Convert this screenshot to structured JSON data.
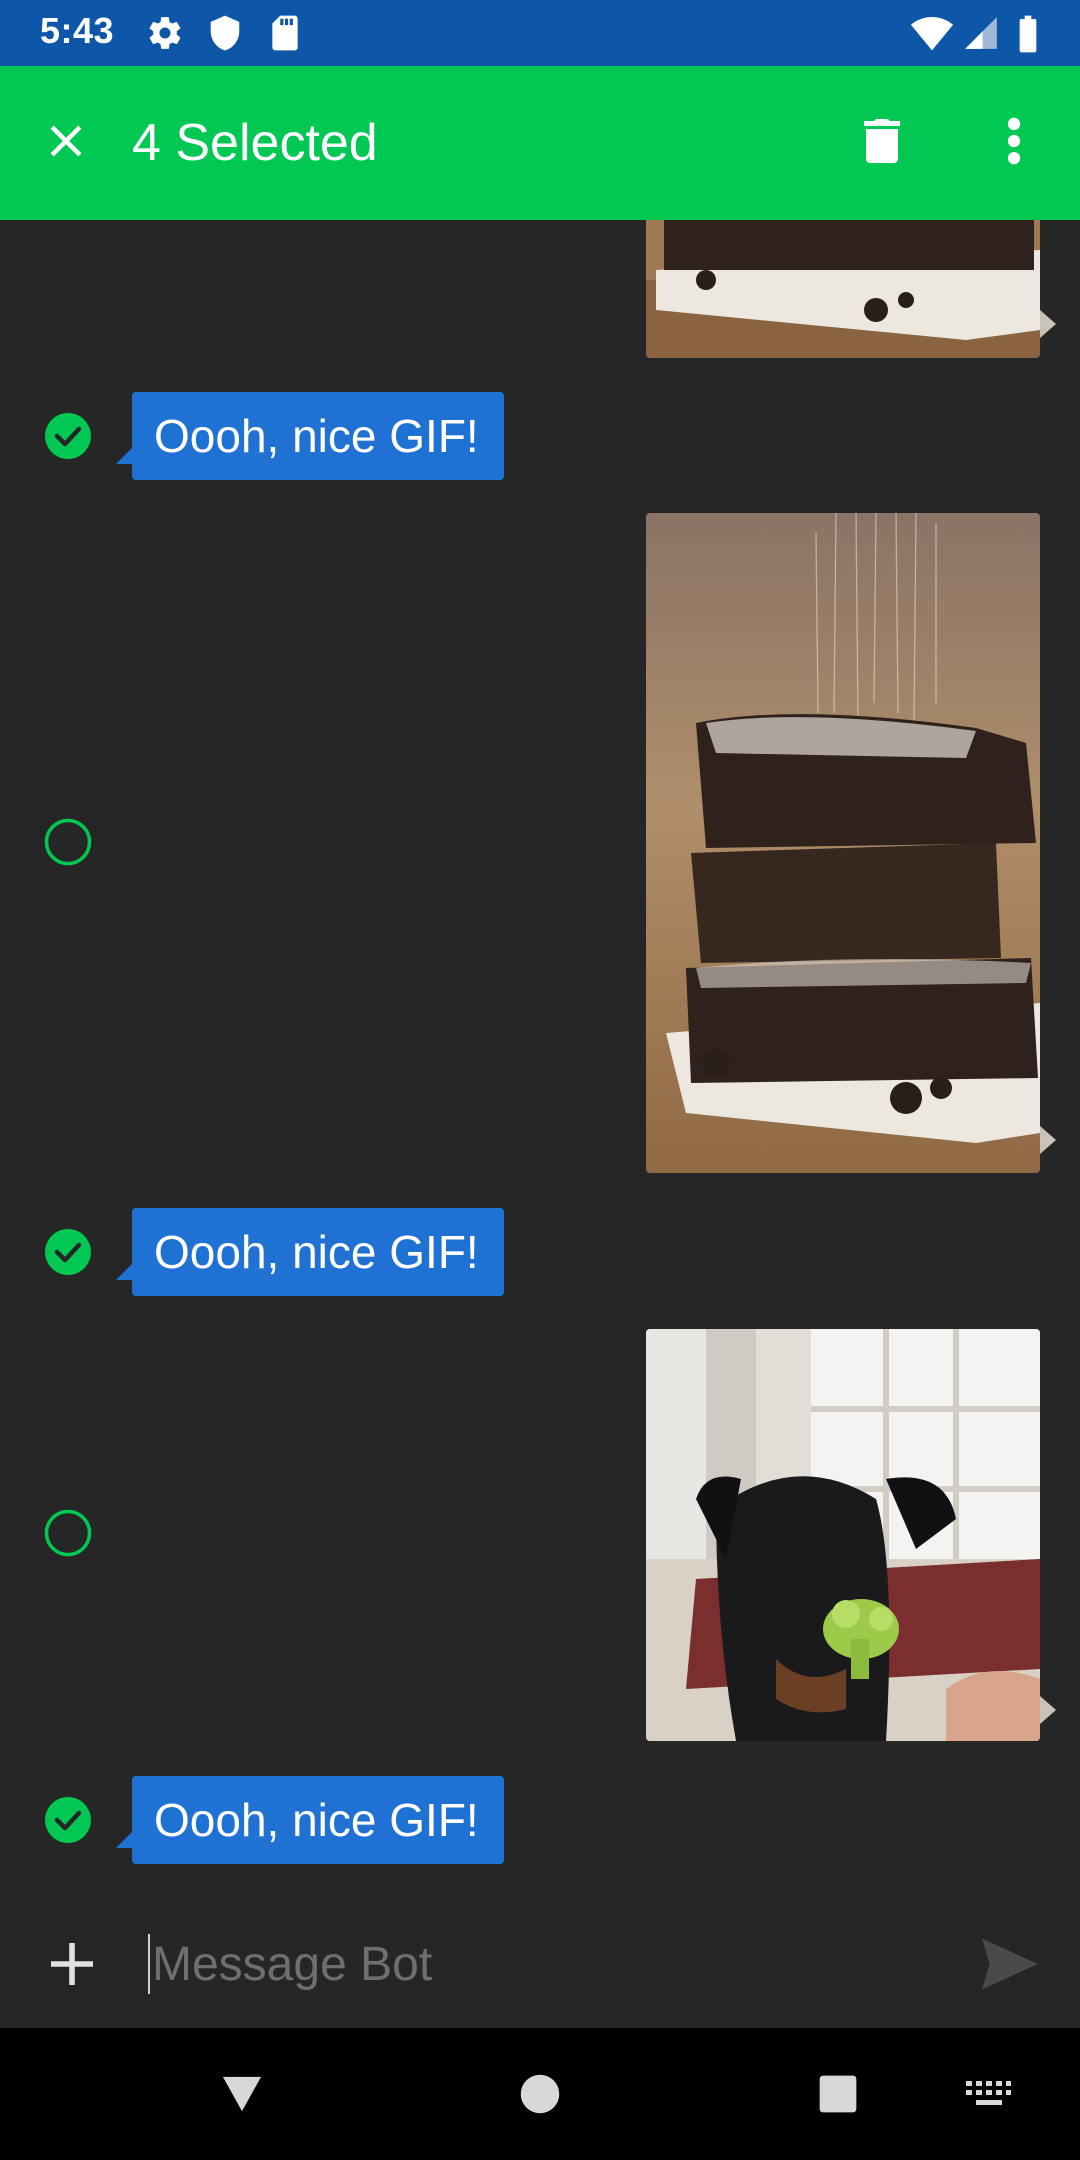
{
  "status_bar": {
    "time": "5:43",
    "icons": [
      "gear-icon",
      "shield-icon",
      "sd-card-icon",
      "wifi-icon",
      "signal-icon",
      "battery-icon"
    ]
  },
  "app_bar": {
    "title": "4 Selected",
    "close_icon": "close-icon",
    "delete_icon": "trash-icon",
    "more_icon": "more-vert-icon",
    "color": "#00c853"
  },
  "messages": [
    {
      "type": "gif",
      "description": "brownie-stack",
      "selected": false
    },
    {
      "type": "text",
      "text": "Oooh, nice GIF!",
      "selected": true
    },
    {
      "type": "gif",
      "description": "brownie-stack",
      "selected": false
    },
    {
      "type": "text",
      "text": "Oooh, nice GIF!",
      "selected": true
    },
    {
      "type": "gif",
      "description": "puppy-broccoli",
      "selected": false
    },
    {
      "type": "text",
      "text": "Oooh, nice GIF!",
      "selected": true
    }
  ],
  "composer": {
    "placeholder": "Message Bot",
    "value": ""
  },
  "colors": {
    "accent": "#00c853",
    "bubble": "#1f72d3",
    "background": "#262626",
    "status_bar": "#0e56a8"
  }
}
